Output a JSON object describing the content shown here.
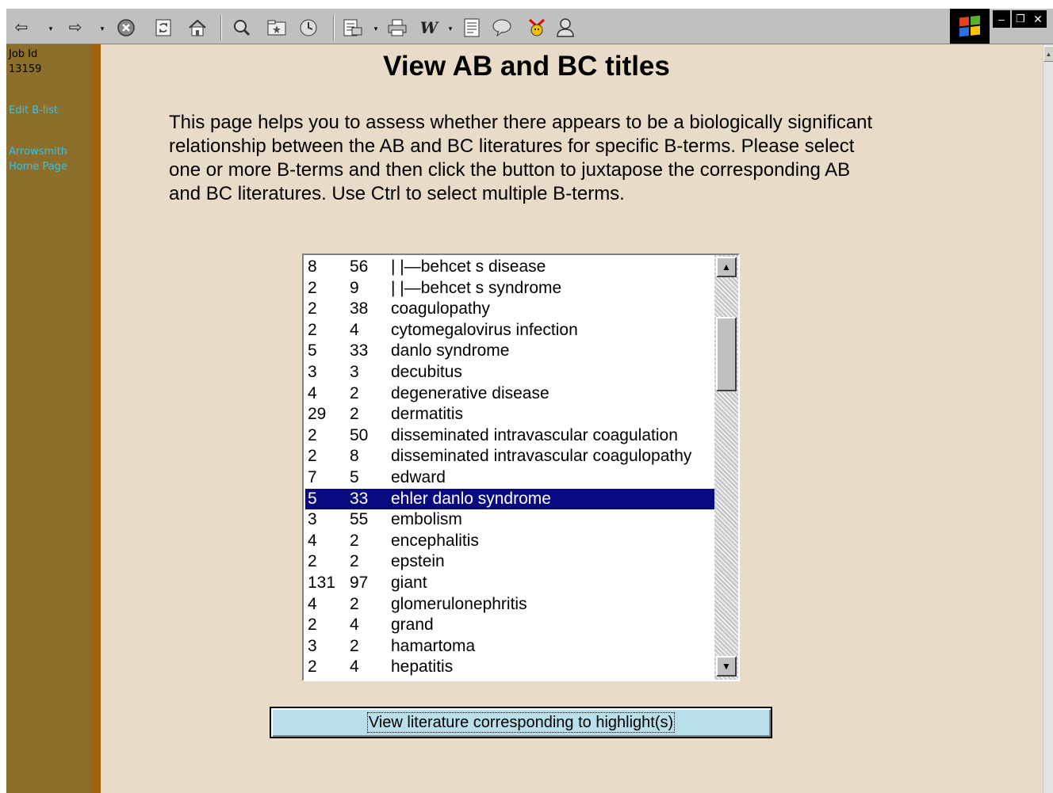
{
  "toolbar": {
    "icons": [
      "back-arrow-icon",
      "forward-arrow-icon",
      "stop-icon",
      "refresh-icon",
      "home-icon",
      "search-icon",
      "favorites-icon",
      "history-icon",
      "mail-icon",
      "print-icon",
      "word-icon",
      "edit-icon",
      "discuss-icon",
      "messenger-icon",
      "user-icon"
    ],
    "window_controls": [
      "minimize-icon",
      "restore-icon",
      "close-icon"
    ]
  },
  "sidebar": {
    "job_label": "Job Id",
    "job_value": "13159",
    "links": [
      {
        "label": "Edit B-list"
      },
      {
        "label": "Arrowsmith Home Page"
      }
    ]
  },
  "main": {
    "title": "View AB and BC titles",
    "intro": "This page helps you to assess whether there appears to be a biologically significant relationship between the AB and BC literatures for specific B-terms. Please select one or more B-terms and then click the button to juxtapose the corresponding AB and BC literatures. Use Ctrl to select multiple B-terms."
  },
  "bterm_list": {
    "rows": [
      {
        "a": "8",
        "b": "56",
        "term": "|     |—behcet s disease",
        "selected": false
      },
      {
        "a": "2",
        "b": "9",
        "term": "|     |—behcet s syndrome",
        "selected": false
      },
      {
        "a": "2",
        "b": "38",
        "term": "coagulopathy",
        "selected": false
      },
      {
        "a": "2",
        "b": "4",
        "term": "cytomegalovirus infection",
        "selected": false
      },
      {
        "a": "5",
        "b": "33",
        "term": "danlo syndrome",
        "selected": false
      },
      {
        "a": "3",
        "b": "3",
        "term": "decubitus",
        "selected": false
      },
      {
        "a": "4",
        "b": "2",
        "term": "degenerative disease",
        "selected": false
      },
      {
        "a": "29",
        "b": "2",
        "term": "dermatitis",
        "selected": false
      },
      {
        "a": "2",
        "b": "50",
        "term": "disseminated intravascular coagulation",
        "selected": false
      },
      {
        "a": "2",
        "b": "8",
        "term": "disseminated intravascular coagulopathy",
        "selected": false
      },
      {
        "a": "7",
        "b": "5",
        "term": "edward",
        "selected": false
      },
      {
        "a": "5",
        "b": "33",
        "term": "ehler danlo syndrome",
        "selected": true
      },
      {
        "a": "3",
        "b": "55",
        "term": "embolism",
        "selected": false
      },
      {
        "a": "4",
        "b": "2",
        "term": "encephalitis",
        "selected": false
      },
      {
        "a": "2",
        "b": "2",
        "term": "epstein",
        "selected": false
      },
      {
        "a": "131",
        "b": "97",
        "term": "giant",
        "selected": false
      },
      {
        "a": "4",
        "b": "2",
        "term": "glomerulonephritis",
        "selected": false
      },
      {
        "a": "2",
        "b": "4",
        "term": "grand",
        "selected": false
      },
      {
        "a": "3",
        "b": "2",
        "term": "hamartoma",
        "selected": false
      },
      {
        "a": "2",
        "b": "4",
        "term": "hepatitis",
        "selected": false
      }
    ]
  },
  "action": {
    "label": "View literature corresponding to highlight(s)"
  },
  "colors": {
    "sidebar": "#8d6e2a",
    "sidebar_edge": "#a4600f",
    "page_bg": "#e8dcc8",
    "link": "#33c4e6",
    "selection": "#0a0a80",
    "button_bg": "#b9e0ea"
  }
}
